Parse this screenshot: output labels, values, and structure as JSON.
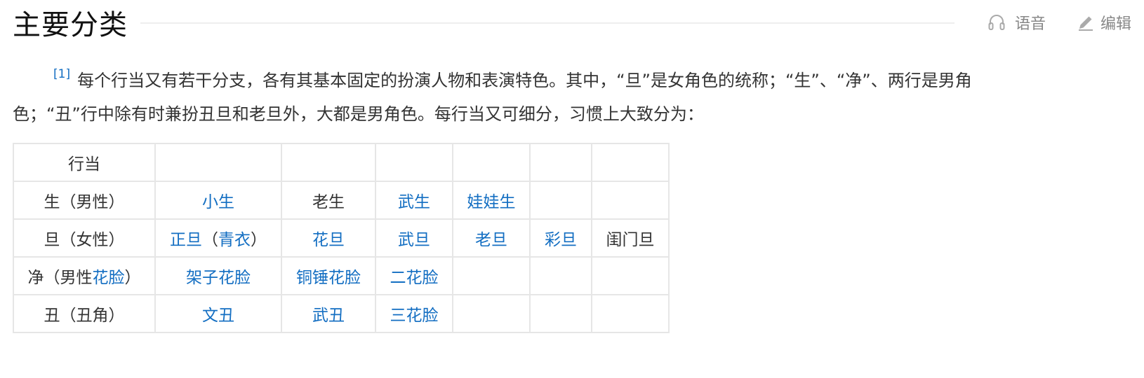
{
  "section": {
    "title": "主要分类",
    "voice_label": "语音",
    "edit_label": "编辑"
  },
  "paragraph": {
    "cite": "[1]",
    "text_line1": "每个行当又有若干分支，各有其基本固定的扮演人物和表演特色。其中，“旦”是女角色的统称；“生”、“净”、两行是男角",
    "text_line2": "色；“丑”行中除有时兼扮丑旦和老旦外，大都是男角色。每行当又可细分，习惯上大致分为："
  },
  "table": {
    "header": "行当",
    "rows": [
      {
        "category": "生（男性）",
        "cells": [
          "小生",
          "老生",
          "武生",
          "娃娃生",
          "",
          ""
        ]
      },
      {
        "category": "旦（女性）",
        "cells": [
          "正旦",
          "花旦",
          "武旦",
          "老旦",
          "彩旦",
          "闺门旦"
        ],
        "extra": {
          "paren_open": "（",
          "qingyi": "青衣",
          "paren_close": "）"
        }
      },
      {
        "category_prefix": "净（男性",
        "category_link": "花脸",
        "category_suffix": "）",
        "cells": [
          "架子花脸",
          "铜锤花脸",
          "二花脸",
          "",
          "",
          ""
        ]
      },
      {
        "category": "丑（丑角）",
        "cells": [
          "文丑",
          "武丑",
          "三花脸",
          "",
          "",
          ""
        ]
      }
    ]
  },
  "colors": {
    "link": "#136ec2",
    "text": "#333333",
    "border": "#e6e6e6"
  }
}
